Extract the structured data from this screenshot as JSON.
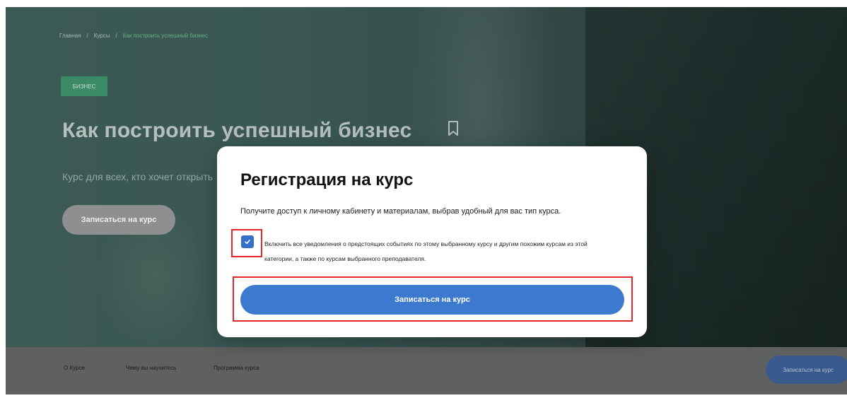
{
  "breadcrumb": {
    "home": "Главная",
    "sep1": "/",
    "courses": "Курсы",
    "sep2": "/",
    "current": "Как построить успешный бизнес"
  },
  "hero": {
    "tag": "БИЗНЕС",
    "title": "Как построить успешный бизнес",
    "subtitle": "Курс для всех, кто хочет открыть",
    "enroll_button": "Записаться на курс",
    "bookmark_icon": "bookmark-icon"
  },
  "subnav": {
    "items": [
      "О Курсе",
      "Чему вы научитесь",
      "Программа курса"
    ],
    "enroll_button": "Записаться на курс"
  },
  "modal": {
    "title": "Регистрация на курс",
    "description": "Получите доступ к личному кабинету и материалам, выбрав удобный для вас тип курса.",
    "checkbox_checked": true,
    "checkbox_label": "Включить все уведомления о предстоящих событиях по этому выбранному курсу и другим похожим курсам из этой категории, а также по курсам выбранного преподавателя.",
    "submit_button": "Записаться на курс"
  },
  "colors": {
    "accent": "#3e79d0",
    "highlight": "#e3262b",
    "tag": "#3d8a69"
  }
}
